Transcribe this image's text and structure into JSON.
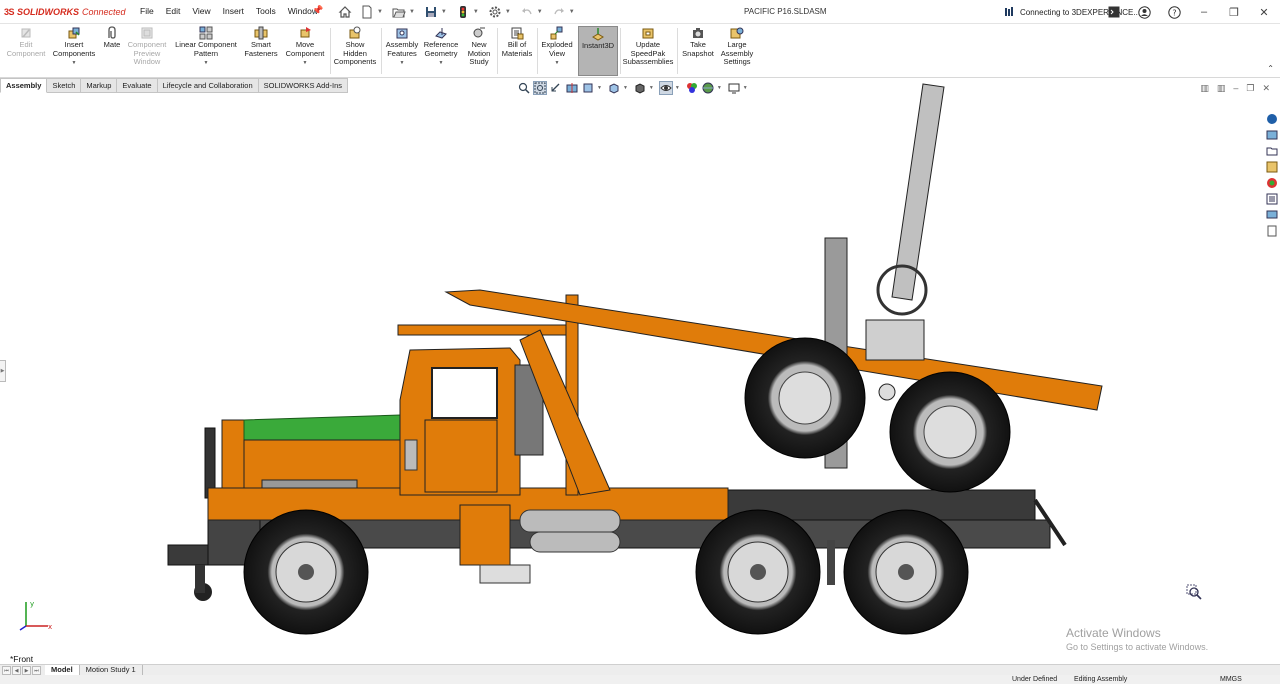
{
  "app": {
    "logo_mark": "3S",
    "logo_brand": "SOLIDWORKS",
    "logo_suffix": "Connected",
    "document_title": "PACIFIC P16.SLDASM",
    "cloud_status": "Connecting to 3DEXPERIENCE...",
    "brand_color": "#d52b1e"
  },
  "menu": [
    "File",
    "Edit",
    "View",
    "Insert",
    "Tools",
    "Window"
  ],
  "quick_access": [
    "home-icon",
    "new-document-icon",
    "open-icon",
    "save-icon",
    "traffic-light-icon",
    "options-gear-icon",
    "undo-icon",
    "redo-icon"
  ],
  "ribbon": {
    "edit_component": "Edit\nComponent",
    "insert_components": "Insert\nComponents",
    "mate": "Mate",
    "component_preview": "Component\nPreview\nWindow",
    "linear_pattern": "Linear Component\nPattern",
    "smart_fasteners": "Smart\nFasteners",
    "move_component": "Move\nComponent",
    "show_hidden": "Show\nHidden\nComponents",
    "assembly_features": "Assembly\nFeatures",
    "reference_geometry": "Reference\nGeometry",
    "new_motion_study": "New\nMotion\nStudy",
    "bill_of_materials": "Bill of\nMaterials",
    "exploded_view": "Exploded\nView",
    "instant3d": "Instant3D",
    "update_speedpak": "Update\nSpeedPak\nSubassemblies",
    "take_snapshot": "Take\nSnapshot",
    "large_assembly": "Large\nAssembly\nSettings"
  },
  "tabs": [
    "Assembly",
    "Sketch",
    "Markup",
    "Evaluate",
    "Lifecycle and Collaboration",
    "SOLIDWORKS Add-Ins"
  ],
  "viewport": {
    "view_name": "*Front",
    "triad_x": "x",
    "triad_y": "y",
    "truck_color": "#e07c0a",
    "green_part_color": "#3aaa3a",
    "dark_part_color": "#3a3a3a"
  },
  "watermark": {
    "line1": "Activate Windows",
    "line2": "Go to Settings to activate Windows."
  },
  "bottom_tabs": [
    "Model",
    "Motion Study 1"
  ],
  "status": {
    "state": "Under Defined",
    "mode": "Editing Assembly",
    "units": "MMGS"
  }
}
